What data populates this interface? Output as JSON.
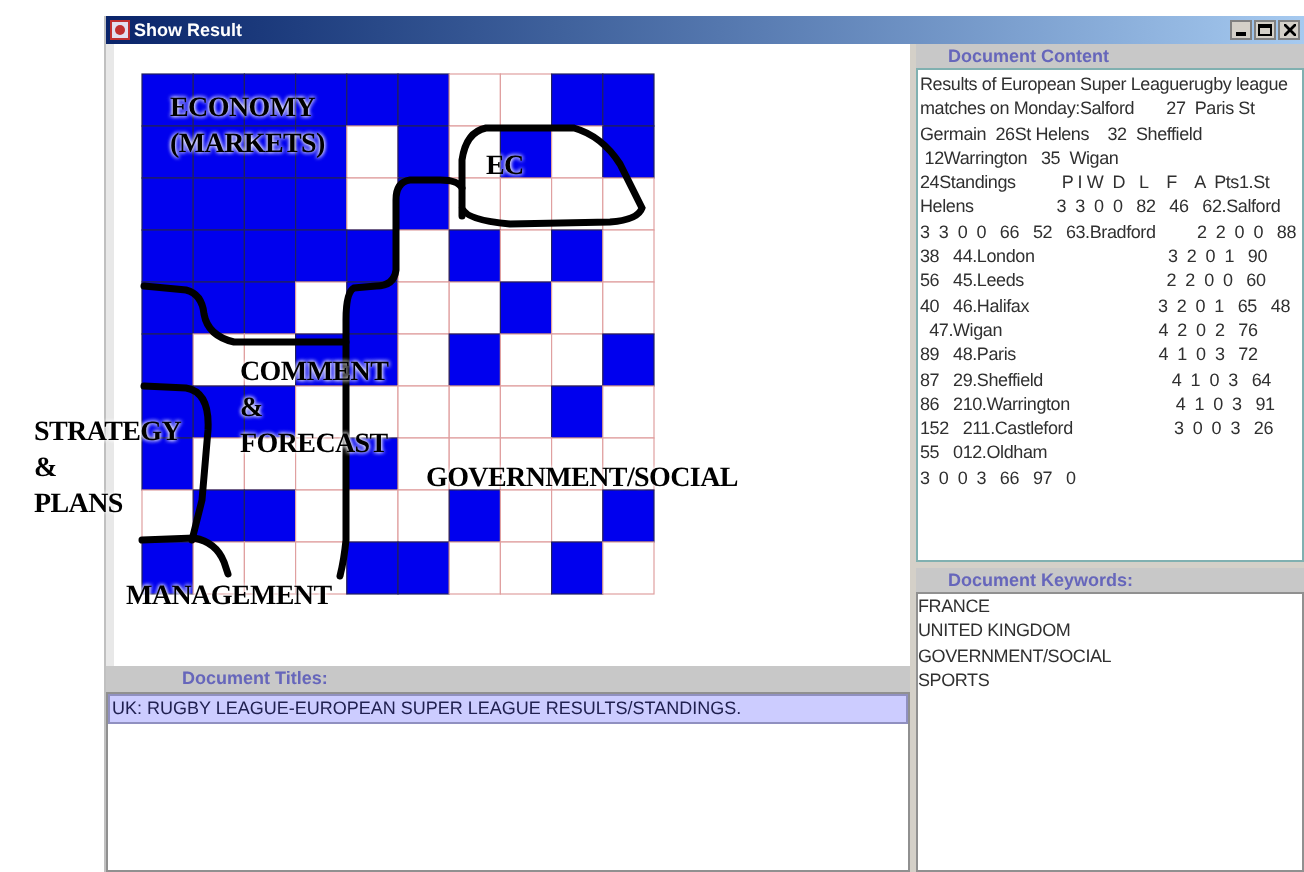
{
  "window": {
    "title": "Show Result"
  },
  "map": {
    "labels": [
      {
        "lines": [
          "ECONOMY",
          "(MARKETS)"
        ]
      },
      {
        "lines": [
          "EC"
        ]
      },
      {
        "lines": [
          "COMMENT",
          "&",
          "FORECAST"
        ]
      },
      {
        "lines": [
          "STRATEGY",
          "&",
          "PLANS"
        ]
      },
      {
        "lines": [
          "GOVERNMENT/SOCIAL"
        ]
      },
      {
        "lines": [
          "MANAGEMENT"
        ]
      }
    ],
    "grid": {
      "rows": [
        {
          "filled": [
            true,
            true,
            true,
            true,
            true,
            true,
            false,
            false,
            true,
            true
          ]
        },
        {
          "filled": [
            true,
            true,
            true,
            true,
            false,
            true,
            false,
            true,
            false,
            true
          ]
        },
        {
          "filled": [
            true,
            true,
            true,
            true,
            false,
            true,
            false,
            false,
            false,
            false
          ]
        },
        {
          "filled": [
            true,
            true,
            true,
            true,
            true,
            false,
            true,
            false,
            true,
            false
          ]
        },
        {
          "filled": [
            true,
            true,
            true,
            false,
            true,
            false,
            false,
            true,
            false,
            false
          ]
        },
        {
          "filled": [
            true,
            false,
            false,
            true,
            true,
            false,
            true,
            false,
            false,
            true
          ]
        },
        {
          "filled": [
            true,
            true,
            true,
            false,
            false,
            false,
            false,
            false,
            true,
            false
          ]
        },
        {
          "filled": [
            true,
            false,
            false,
            false,
            true,
            false,
            false,
            false,
            false,
            false
          ]
        },
        {
          "filled": [
            false,
            true,
            true,
            false,
            false,
            false,
            true,
            false,
            false,
            true
          ]
        },
        {
          "filled": [
            true,
            false,
            false,
            false,
            true,
            true,
            false,
            false,
            true,
            false
          ]
        }
      ]
    }
  },
  "document_titles": {
    "header": "Document Titles:",
    "items": [
      {
        "text": "UK: RUGBY LEAGUE-EUROPEAN SUPER LEAGUE RESULTS/STANDINGS.",
        "selected": true
      }
    ]
  },
  "document_content": {
    "header": "Document Content",
    "lines": [
      "Results of European Super Leaguerugby league",
      "matches on Monday:Salford       27  Paris St",
      "Germain  26St Helens    32  Sheffield",
      " 12Warrington   35  Wigan",
      "24Standings          P I W  D   L    F    A  Pts1.St",
      "Helens                  3  3  0  0   82   46   62.Salford",
      "3  3  0  0   66   52   63.Bradford         2  2  0  0   88",
      "38   44.London                             3  2  0  1   90",
      "56   45.Leeds                               2  2  0  0   60",
      "40   46.Halifax                            3  2  0  1   65   48",
      "  47.Wigan                                  4  2  0  2   76",
      "89   48.Paris                               4  1  0  3   72",
      "87   29.Sheffield                            4  1  0  3   64",
      "86   210.Warrington                       4  1  0  3   91",
      "152   211.Castleford                      3  0  0  3   26",
      "55   012.Oldham",
      "3  0  0  3   66   97   0"
    ]
  },
  "document_keywords": {
    "header": "Document Keywords:",
    "items": [
      "FRANCE",
      "UNITED KINGDOM",
      "GOVERNMENT/SOCIAL",
      "SPORTS"
    ]
  }
}
